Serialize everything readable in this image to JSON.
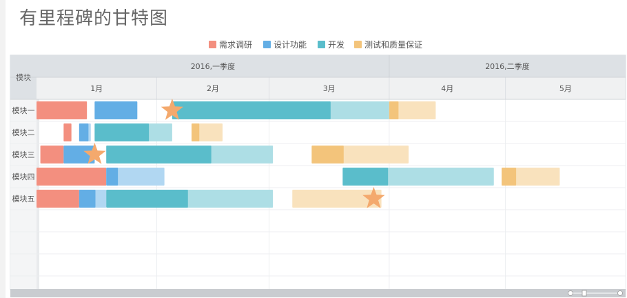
{
  "title": "有里程碑的甘特图",
  "colors": {
    "research": "#f38f7f",
    "design": "#63aee5",
    "dev": "#5abdcb",
    "test": "#f3c47b",
    "milestone": "#f4a96d"
  },
  "chart_data": {
    "type": "gantt",
    "title": "有里程碑的甘特图",
    "row_header": "模块",
    "quarters": [
      "2016,一季度",
      "2016,二季度"
    ],
    "months": [
      "1月",
      "2月",
      "3月",
      "4月",
      "5月"
    ],
    "x_range": [
      "2016-01-01",
      "2016-06-01"
    ],
    "legend": [
      {
        "key": "research",
        "label": "需求调研"
      },
      {
        "key": "design",
        "label": "设计功能"
      },
      {
        "key": "dev",
        "label": "开发"
      },
      {
        "key": "test",
        "label": "测试和质量保证"
      }
    ],
    "rows": [
      {
        "name": "模块一",
        "tasks": [
          {
            "series": "research",
            "start": "2016-01-01",
            "end": "2016-01-14",
            "progress": 1.0
          },
          {
            "series": "design",
            "start": "2016-01-16",
            "end": "2016-01-27",
            "progress": 1.0
          },
          {
            "series": "dev",
            "start": "2016-02-05",
            "end": "2016-04-01",
            "progress": 0.73
          },
          {
            "series": "test",
            "start": "2016-04-01",
            "end": "2016-04-13",
            "progress": 0.2
          }
        ],
        "milestones": [
          "2016-02-05"
        ]
      },
      {
        "name": "模块二",
        "tasks": [
          {
            "series": "research",
            "start": "2016-01-08",
            "end": "2016-01-10",
            "progress": 1.0
          },
          {
            "series": "design",
            "start": "2016-01-12",
            "end": "2016-01-15",
            "progress": 0.8
          },
          {
            "series": "dev",
            "start": "2016-01-16",
            "end": "2016-02-05",
            "progress": 0.7
          },
          {
            "series": "test",
            "start": "2016-02-10",
            "end": "2016-02-18",
            "progress": 0.25
          }
        ],
        "milestones": []
      },
      {
        "name": "模块三",
        "tasks": [
          {
            "series": "research",
            "start": "2016-01-02",
            "end": "2016-01-08",
            "progress": 1.0
          },
          {
            "series": "design",
            "start": "2016-01-08",
            "end": "2016-01-16",
            "progress": 1.0
          },
          {
            "series": "dev",
            "start": "2016-01-19",
            "end": "2016-03-02",
            "progress": 0.63
          },
          {
            "series": "test",
            "start": "2016-03-12",
            "end": "2016-04-06",
            "progress": 0.33
          }
        ],
        "milestones": [
          "2016-01-16"
        ]
      },
      {
        "name": "模块四",
        "tasks": [
          {
            "series": "research",
            "start": "2016-01-01",
            "end": "2016-01-19",
            "progress": 1.0
          },
          {
            "series": "design",
            "start": "2016-01-19",
            "end": "2016-02-03",
            "progress": 0.2
          },
          {
            "series": "dev",
            "start": "2016-03-20",
            "end": "2016-04-28",
            "progress": 0.3
          },
          {
            "series": "test",
            "start": "2016-04-30",
            "end": "2016-05-15",
            "progress": 0.25
          }
        ],
        "milestones": []
      },
      {
        "name": "模块五",
        "tasks": [
          {
            "series": "research",
            "start": "2016-01-01",
            "end": "2016-01-12",
            "progress": 1.0
          },
          {
            "series": "design",
            "start": "2016-01-12",
            "end": "2016-01-19",
            "progress": 0.6
          },
          {
            "series": "dev",
            "start": "2016-01-19",
            "end": "2016-03-02",
            "progress": 0.49
          },
          {
            "series": "test",
            "start": "2016-03-07",
            "end": "2016-03-30",
            "progress": 0.0
          }
        ],
        "milestones": [
          "2016-03-28"
        ]
      }
    ]
  }
}
